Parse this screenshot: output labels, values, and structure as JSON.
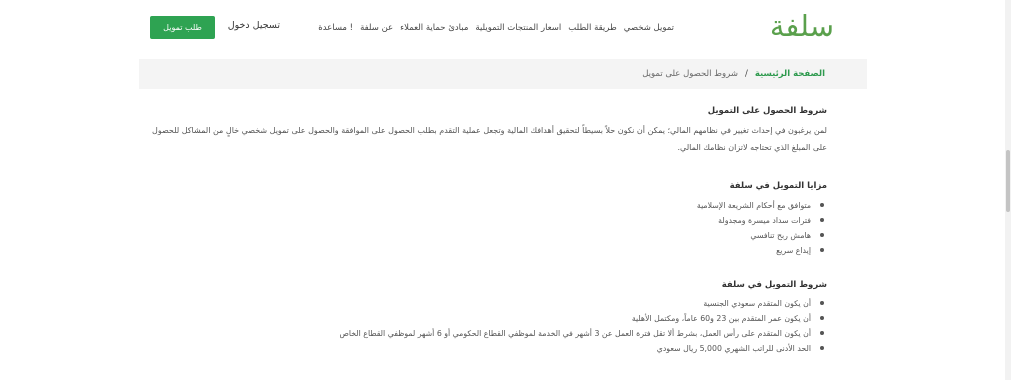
{
  "header": {
    "logo_text": "سلفة",
    "nav": [
      "تمويل شخصي",
      "طريقة الطلب",
      "اسعار المنتجات التمويلية",
      "مبادئ حماية العملاء",
      "عن سلفة",
      "مساعدة !"
    ],
    "login_label": "تسجيل دخول",
    "apply_label": "طلب تمويل"
  },
  "breadcrumb": {
    "home": "الصفحة الرئيسية",
    "separator": "/",
    "current": "شروط الحصول على تمويل"
  },
  "content": {
    "intro_title": "شروط  الحصول على التمويل",
    "intro_text": "لمن يرغبون في إحداث تغيير في نظامهم المالي؛ يمكن أن نكون حلاً بسيطاً لتحقيق أهدافك المالية وتجعل عملية التقدم بطلب الحصول على الموافقة والحصول على تمويل شخصي خالٍ من المشاكل للحصول على المبلغ الذي تحتاجه لاتزان نظامك المالي.",
    "advantages_title": "مزايا التمويل في سلفة",
    "advantages": [
      "متوافق مع أحكام الشريعة الإسلامية",
      "فترات سداد ميسرة ومجدولة",
      "هامش ربح تنافسي",
      "إيداع سريع"
    ],
    "conditions_title": "شروط التمويل في سلفة",
    "conditions": [
      "أن يكون المتقدم سعودي الجنسية",
      "أن يكون عمر المتقدم بين 23 و60 عاماً، ومكتمل الأهلية",
      "أن يكون المتقدم على رأس العمل، بشرط ألا تقل فترة العمل عن 3 أشهر في الخدمة لموظفي القطاع الحكومي أو 6 أشهر لموظفي القطاع الخاص",
      "الحد الأدنى للراتب الشهري 5,000 ريال سعودي"
    ]
  },
  "colors": {
    "brand_green": "#5aa04c",
    "button_green": "#2ea352",
    "link_green": "#2e9a4e",
    "breadcrumb_bg": "#f4f4f4"
  }
}
